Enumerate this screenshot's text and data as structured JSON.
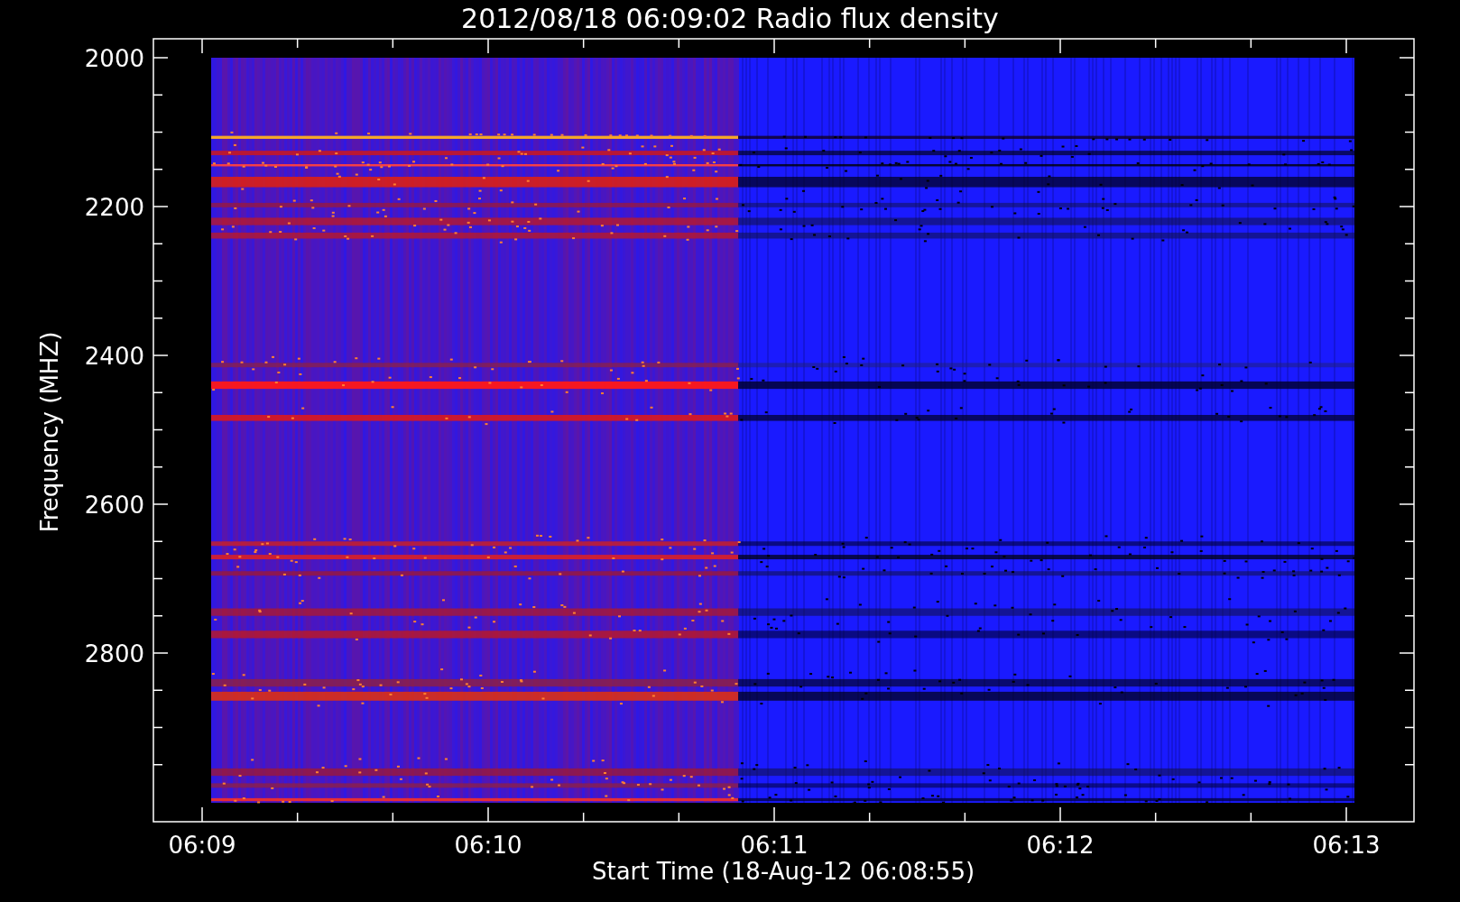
{
  "title": "2012/08/18 06:09:02 Radio flux density",
  "y_axis": {
    "label": "Frequency (MHZ)",
    "ticks": [
      "2000",
      "2200",
      "2400",
      "2600",
      "2800"
    ]
  },
  "x_axis": {
    "label": "Start Time (18-Aug-12 06:08:55)",
    "ticks": [
      "06:09",
      "06:10",
      "06:11",
      "06:12",
      "06:13"
    ]
  }
}
